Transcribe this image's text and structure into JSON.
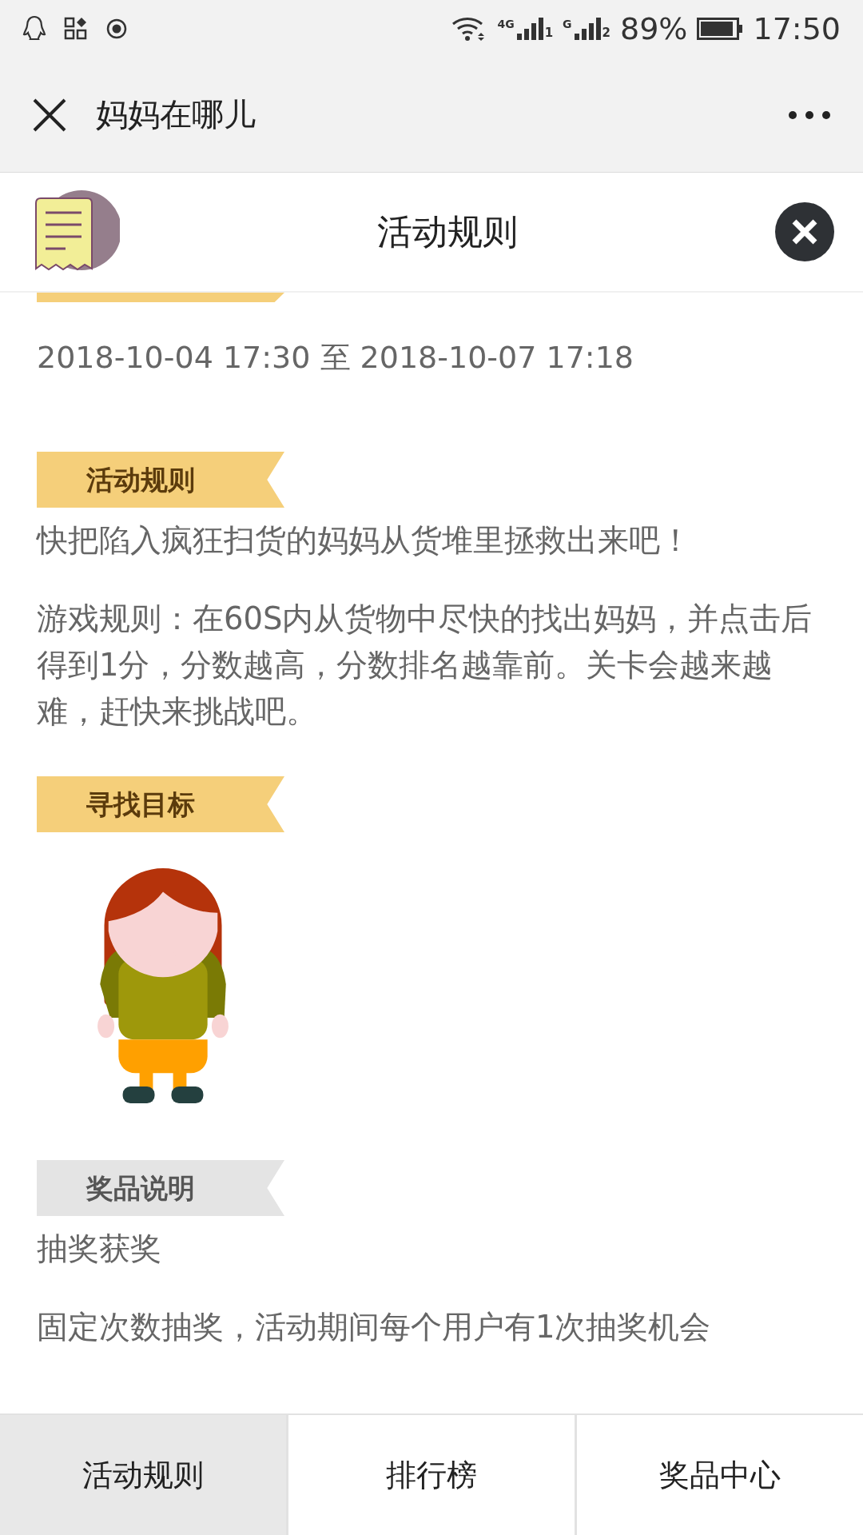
{
  "status_bar": {
    "signal_1_label": "4G",
    "signal_1_sim": "1",
    "signal_2_label": "G",
    "signal_2_sim": "2",
    "battery": "89%",
    "time": "17:50"
  },
  "nav_bar": {
    "title": "妈妈在哪儿"
  },
  "header": {
    "title": "活动规则"
  },
  "period": "2018-10-04 17:30 至 2018-10-07 17:18",
  "sections": [
    {
      "heading": "活动规则",
      "kind": "text",
      "color": "#f5cf7a",
      "paragraphs": [
        "快把陷入疯狂扫货的妈妈从货堆里拯救出来吧！",
        "游戏规则：在60S内从货物中尽快的找出妈妈，并点击后得到1分，分数越高，分数排名越靠前。关卡会越来越难，赶快来挑战吧。"
      ]
    },
    {
      "heading": "寻找目标",
      "kind": "figure",
      "color": "#f5cf7a"
    },
    {
      "heading": "奖品说明",
      "kind": "text",
      "color": "#e4e4e4",
      "paragraphs": [
        "抽奖获奖",
        "固定次数抽奖，活动期间每个用户有1次抽奖机会"
      ]
    }
  ],
  "tabs": [
    {
      "label": "活动规则",
      "selected": true
    },
    {
      "label": "排行榜",
      "selected": false
    },
    {
      "label": "奖品中心",
      "selected": false
    }
  ]
}
